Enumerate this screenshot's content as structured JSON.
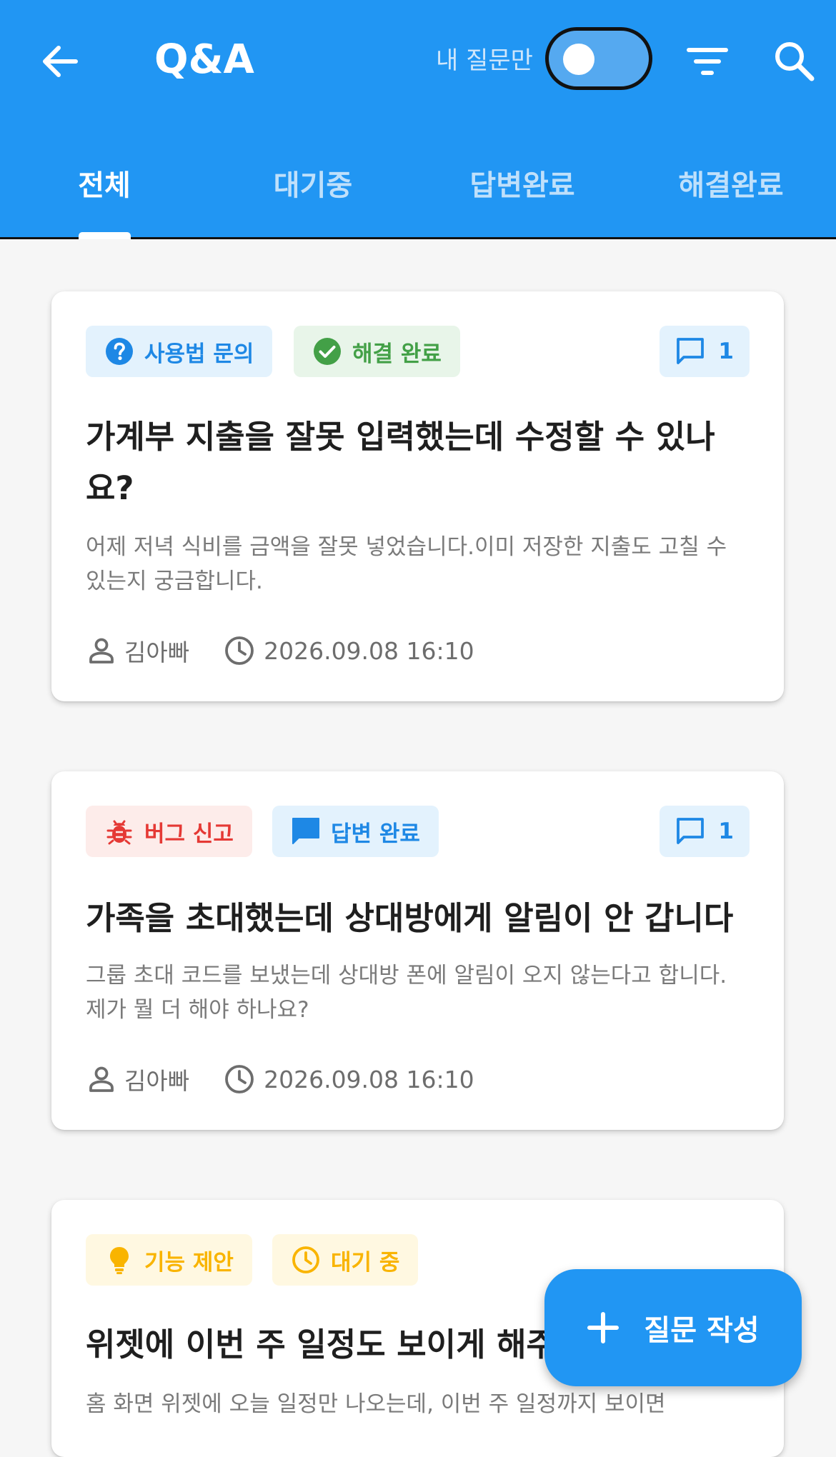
{
  "appbar": {
    "title": "Q&A",
    "my_questions_label": "내 질문만",
    "my_questions_toggle_on": false
  },
  "tabs": [
    {
      "label": "전체",
      "active": true
    },
    {
      "label": "대기중",
      "active": false
    },
    {
      "label": "답변완료",
      "active": false
    },
    {
      "label": "해결완료",
      "active": false
    }
  ],
  "questions": [
    {
      "category": "사용법 문의",
      "category_icon": "help-circle-icon",
      "status": "해결 완료",
      "status_icon": "check-circle-icon",
      "comment_count": "1",
      "title": "가계부 지출을 잘못 입력했는데 수정할 수 있나요?",
      "body": "어제 저녁 식비를 금액을 잘못 넣었습니다.이미 저장한 지출도 고칠 수 있는지 궁금합니다.",
      "author": "김아빠",
      "date": "2026.09.08 16:10"
    },
    {
      "category": "버그 신고",
      "category_icon": "bug-icon",
      "status": "답변 완료",
      "status_icon": "chat-bubble-icon",
      "comment_count": "1",
      "title": "가족을 초대했는데 상대방에게 알림이 안 갑니다",
      "body": "그룹 초대 코드를 보냈는데 상대방 폰에 알림이 오지 않는다고 합니다.제가 뭘 더 해야 하나요?",
      "author": "김아빠",
      "date": "2026.09.08 16:10"
    },
    {
      "category": "기능 제안",
      "category_icon": "lightbulb-icon",
      "status": "대기 중",
      "status_icon": "clock-icon",
      "title": "위젯에 이번 주 일정도 보이게 해주",
      "body": "홈 화면 위젯에 오늘 일정만 나오는데, 이번 주 일정까지 보이면"
    }
  ],
  "fab": {
    "label": "질문 작성",
    "icon": "plus-icon"
  },
  "colors": {
    "primary": "#2196f3",
    "usage_chip_bg": "#e3f2fd",
    "usage_chip_text": "#1e88e5",
    "resolved_chip_bg": "#e8f5e9",
    "resolved_chip_text": "#43a047",
    "bug_chip_bg": "#fdecea",
    "bug_chip_text": "#e53935",
    "idea_chip_bg": "#fff8e1",
    "idea_chip_text": "#f9b400"
  }
}
